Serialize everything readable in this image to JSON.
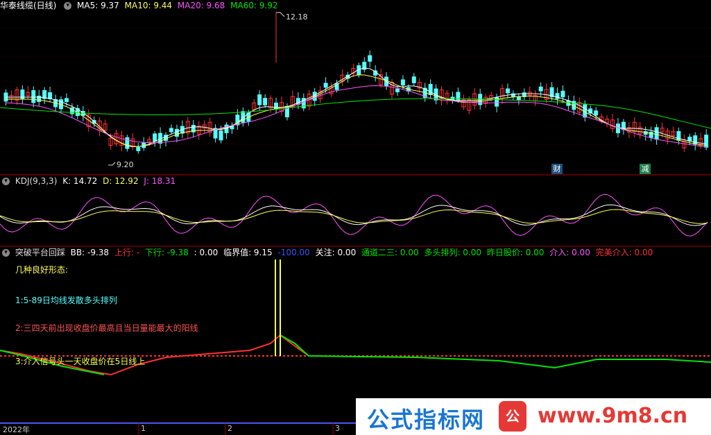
{
  "header": {
    "title": "华泰线缆(日线)",
    "ma5": "MA5: 9.37",
    "ma10": "MA10: 9.44",
    "ma20": "MA20: 9.68",
    "ma60": "MA60: 9.92"
  },
  "price_panel": {
    "high_label": "12.18",
    "low_label": "9.20",
    "marker1": "财",
    "marker2": "减"
  },
  "kdj": {
    "title": "KDJ(9,3,3)",
    "k": "K: 14.72",
    "d": "D: 12.92",
    "j": "J: 18.31"
  },
  "indicator": {
    "title": "突破平台回踩",
    "bb": "BB: -9.38",
    "up": "上行: -",
    "down": "下行: -9.38",
    "zero": ": 0.00",
    "crit": "临界值: 9.15",
    "neg100": "-100.00",
    "focus": "关注: 0.00",
    "channel": "通道二三: 0.00",
    "bull": "多头排列: 0.00",
    "prevclose": "昨日股价: 0.00",
    "entry": "介入: 0.00",
    "perfect": "完美介入: 0.00"
  },
  "tips": {
    "heading": "几种良好形态:",
    "t1": "1:5-89日均线发散多头排列",
    "t2": "2:三四天前出现收盘价最高且当日量能最大的阳线",
    "t3": "3:介入信号头一天收盘价在5日线上"
  },
  "axis": {
    "year": "2022年",
    "m1": "1",
    "m2": "2",
    "m3": "3"
  },
  "watermark": {
    "left": "公式指标网",
    "seal": "公",
    "right": "www.9m8.cn"
  },
  "colors": {
    "up": "#ff3232",
    "down": "#54ffff",
    "ma5": "#ffffff",
    "ma10": "#ffff54",
    "ma20": "#ff54ff",
    "ma60": "#00e600",
    "kdj_k": "#ffffff",
    "kdj_d": "#ffff54",
    "kdj_j": "#ff54ff"
  },
  "chart_data": {
    "type": "candlestick",
    "ylim": [
      9.0,
      12.4
    ],
    "high": 12.18,
    "low": 9.2,
    "k_last": 14.72,
    "d_last": 12.92,
    "j_last": 18.31
  }
}
